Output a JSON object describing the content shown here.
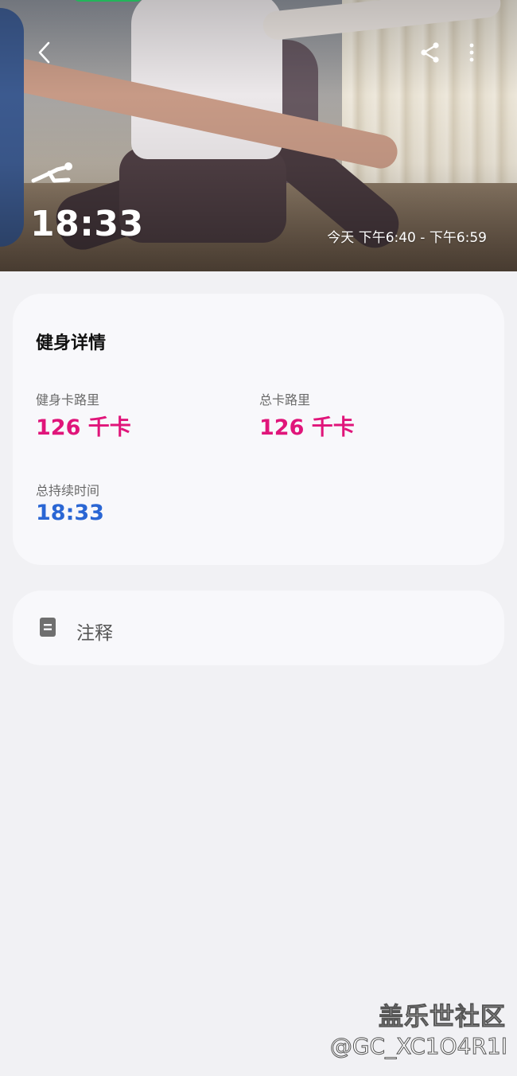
{
  "header": {
    "back_icon": "chevron-left-icon",
    "share_icon": "share-icon",
    "more_icon": "more-vertical-icon",
    "workout_icon": "yoga-pose-icon",
    "duration": "18:33",
    "time_range": "今天 下午6:40 - 下午6:59"
  },
  "details": {
    "title": "健身详情",
    "metrics": [
      {
        "label": "健身卡路里",
        "value": "126 千卡",
        "color": "#e0157a"
      },
      {
        "label": "总卡路里",
        "value": "126 千卡",
        "color": "#e0157a"
      },
      {
        "label": "总持续时间",
        "value": "18:33",
        "color": "#2a66d4"
      }
    ]
  },
  "notes": {
    "icon": "note-document-icon",
    "label": "注释"
  },
  "watermark": {
    "line1": "盖乐世社区",
    "line2": "@GC_XC1O4R1I"
  }
}
